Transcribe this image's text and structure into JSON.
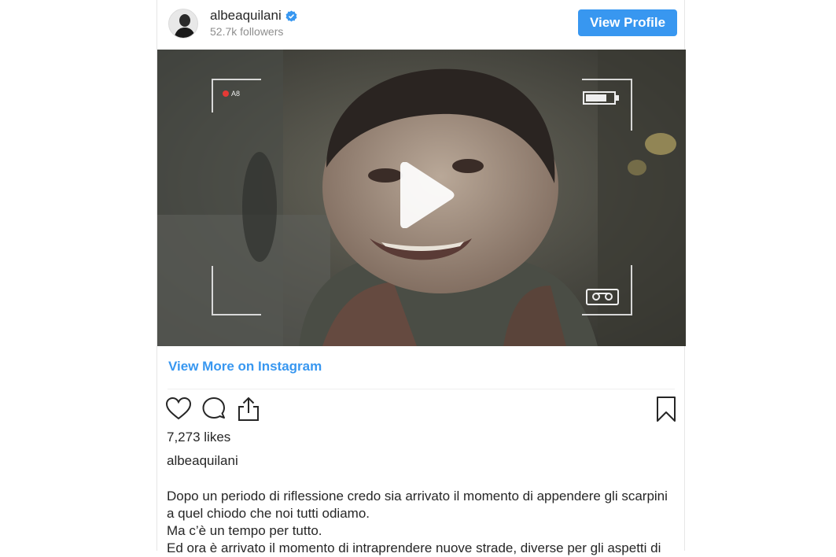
{
  "header": {
    "username": "albeaquilani",
    "followers": "52.7k followers",
    "view_profile_label": "View Profile",
    "verified_icon": "verified-badge-icon"
  },
  "media": {
    "overlay_label": "A8",
    "play_icon": "play-icon",
    "battery_icon": "battery-icon",
    "tape_icon": "cassette-icon"
  },
  "view_more_label": "View More on Instagram",
  "actions": {
    "like_icon": "heart-icon",
    "comment_icon": "comment-icon",
    "share_icon": "share-icon",
    "save_icon": "bookmark-icon"
  },
  "likes": "7,273 likes",
  "caption": {
    "username": "albeaquilani",
    "lines": [
      "Dopo un periodo di riflessione credo sia arrivato il momento di appendere gli scarpini a quel chiodo che noi tutti odiamo.",
      "Ma c’è un tempo per tutto.",
      "Ed ora è arrivato il momento di intraprendere nuove strade, diverse per gli aspetti di"
    ]
  },
  "colors": {
    "accent": "#3897f0",
    "text": "#262626",
    "muted": "#8e8e8e"
  }
}
